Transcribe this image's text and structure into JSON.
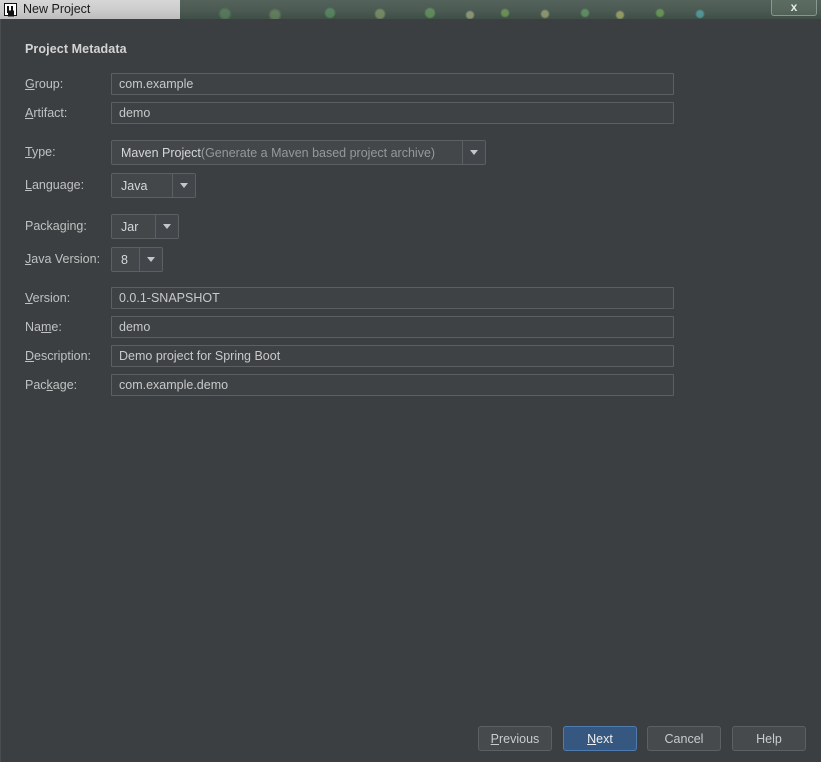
{
  "window": {
    "title": "New Project",
    "app_icon": "intellij-idea-icon",
    "close_label": "x"
  },
  "panel": {
    "heading": "Project Metadata"
  },
  "fields": {
    "group": {
      "label_pre": "",
      "label_mnemonic": "G",
      "label_post": "roup:",
      "value": "com.example"
    },
    "artifact": {
      "label_pre": "",
      "label_mnemonic": "A",
      "label_post": "rtifact:",
      "value": "demo"
    },
    "type": {
      "label_pre": "",
      "label_mnemonic": "T",
      "label_post": "ype:",
      "value": "Maven Project",
      "value_note": " (Generate a Maven based project archive)"
    },
    "language": {
      "label_pre": "",
      "label_mnemonic": "L",
      "label_post": "anguage:",
      "value": "Java"
    },
    "packaging": {
      "label_pre": "Packa",
      "label_mnemonic": "g",
      "label_post": "ing:",
      "value": "Jar"
    },
    "java_version": {
      "label_pre": "",
      "label_mnemonic": "J",
      "label_post": "ava Version:",
      "value": "8"
    },
    "version": {
      "label_pre": "",
      "label_mnemonic": "V",
      "label_post": "ersion:",
      "value": "0.0.1-SNAPSHOT"
    },
    "name": {
      "label_pre": "Na",
      "label_mnemonic": "m",
      "label_post": "e:",
      "value": "demo"
    },
    "description": {
      "label_pre": "",
      "label_mnemonic": "D",
      "label_post": "escription:",
      "value": "Demo project for Spring Boot"
    },
    "package": {
      "label_pre": "Pac",
      "label_mnemonic": "k",
      "label_post": "age:",
      "value": "com.example.demo"
    }
  },
  "buttons": {
    "previous": {
      "pre": "",
      "mnemonic": "P",
      "post": "revious"
    },
    "next": {
      "pre": "",
      "mnemonic": "N",
      "post": "ext"
    },
    "cancel": {
      "pre": "Cancel",
      "mnemonic": "",
      "post": ""
    },
    "help": {
      "pre": "Help",
      "mnemonic": "",
      "post": ""
    }
  },
  "colors": {
    "background": "#3c3f41",
    "field_border": "#5c6063",
    "primary_button": "#365880",
    "primary_button_border": "#4e7bb0",
    "text": "#bfc1c2"
  }
}
